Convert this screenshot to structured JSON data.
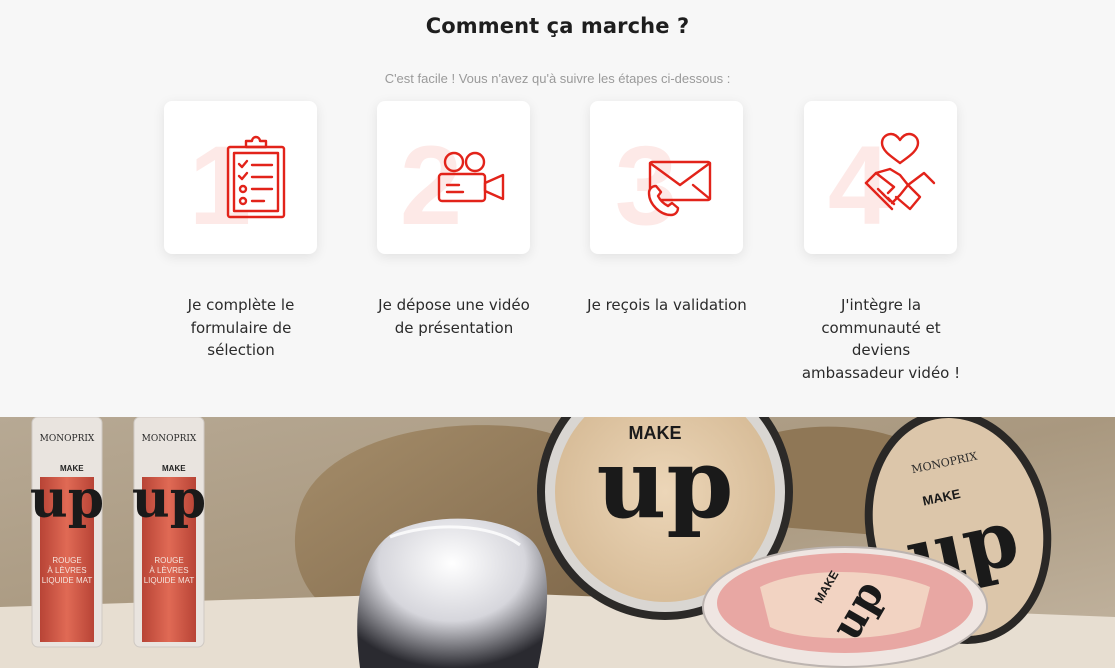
{
  "section": {
    "title": "Comment ça marche ?",
    "subtitle": "C'est facile ! Vous n'avez qu'à suivre les étapes ci-dessous :"
  },
  "accent_color": "#e2231a",
  "steps": [
    {
      "number": "1",
      "icon": "clipboard-checklist-icon",
      "label": "Je complète le formulaire de sélection"
    },
    {
      "number": "2",
      "icon": "video-camera-icon",
      "label": "Je dépose une vidéo de présentation"
    },
    {
      "number": "3",
      "icon": "envelope-phone-icon",
      "label": "Je reçois la validation"
    },
    {
      "number": "4",
      "icon": "heart-handshake-icon",
      "label": "J'intègre la communauté et deviens ambassadeur vidéo !"
    }
  ],
  "product_photo": {
    "lipstick_brand": "MONOPRIX",
    "lipstick_line_top": "MAKE",
    "lipstick_line_big": "up",
    "lipstick_desc_1": "ROUGE",
    "lipstick_desc_2": "À LÈVRES",
    "lipstick_desc_3": "LIQUIDE MAT",
    "compact_top": "MAKE",
    "compact_big": "up",
    "compact2_brand": "MONOPRIX",
    "compact2_top": "MAKE",
    "compact2_big": "up",
    "blush_top": "MAKE",
    "blush_big": "up"
  }
}
